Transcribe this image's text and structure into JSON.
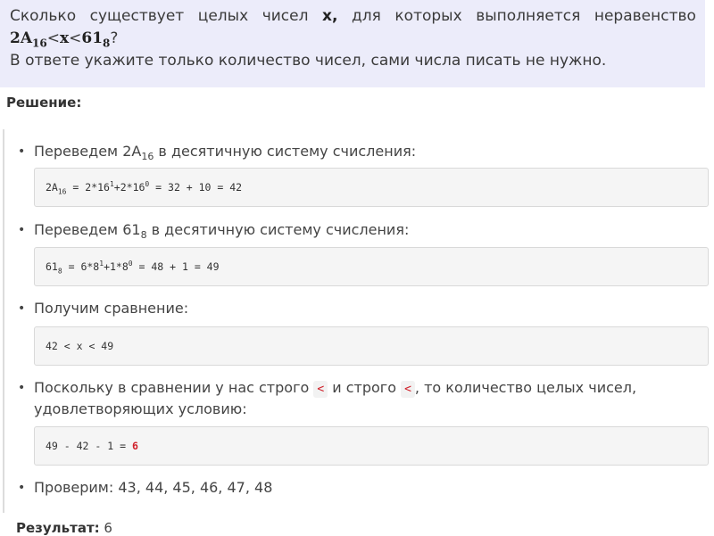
{
  "question": {
    "line1": {
      "words": [
        "Сколько",
        "существует",
        "целых",
        "чисел",
        "x,",
        "для",
        "которых",
        "выполняется",
        "неравенство"
      ]
    },
    "line2": {
      "a_base": "2A",
      "a_sub": "16",
      "lt1": "<",
      "var": "x",
      "lt2": "<",
      "b_base": "61",
      "b_sub": "8",
      "qmark": "?"
    },
    "line3": "В ответе укажите только количество чисел, сами числа писать не нужно."
  },
  "solution_heading": "Решение:",
  "steps": [
    {
      "text_before": "Переведем 2A",
      "sub": "16",
      "text_after": " в десятичную систему счисления:",
      "code": {
        "p1": "2A",
        "p1_sub": "16",
        "p2": " = 2*16",
        "p2_sup": "1",
        "p3": "+2*16",
        "p3_sup": "0",
        "p4": " = 32 + 10 = 42"
      }
    },
    {
      "text_before": "Переведем 61",
      "sub": "8",
      "text_after": " в десятичную систему счисления:",
      "code": {
        "p1": "61",
        "p1_sub": "8",
        "p2": " = 6*8",
        "p2_sup": "1",
        "p3": "+1*8",
        "p3_sup": "0",
        "p4": " = 48 + 1 = 49"
      }
    },
    {
      "text": "Получим сравнение:",
      "code": "42 < x < 49"
    },
    {
      "line1_a": "Поскольку в сравнении у нас строго ",
      "inline1": "<",
      "line1_b": " и строго ",
      "inline2": "<",
      "line1_c": ", то количество целых чисел,",
      "line2": "удовлетворяющих условию:",
      "code_prefix": "49 - 42 - 1 = ",
      "code_answer": "6"
    },
    {
      "text": "Проверим: 43, 44, 45, 46, 47, 48"
    }
  ],
  "result": {
    "label": "Результат:",
    "value": "6"
  },
  "colors": {
    "question_bg": "#ececfa",
    "answer_red": "#d0202a",
    "code_bg": "#f5f5f5"
  }
}
